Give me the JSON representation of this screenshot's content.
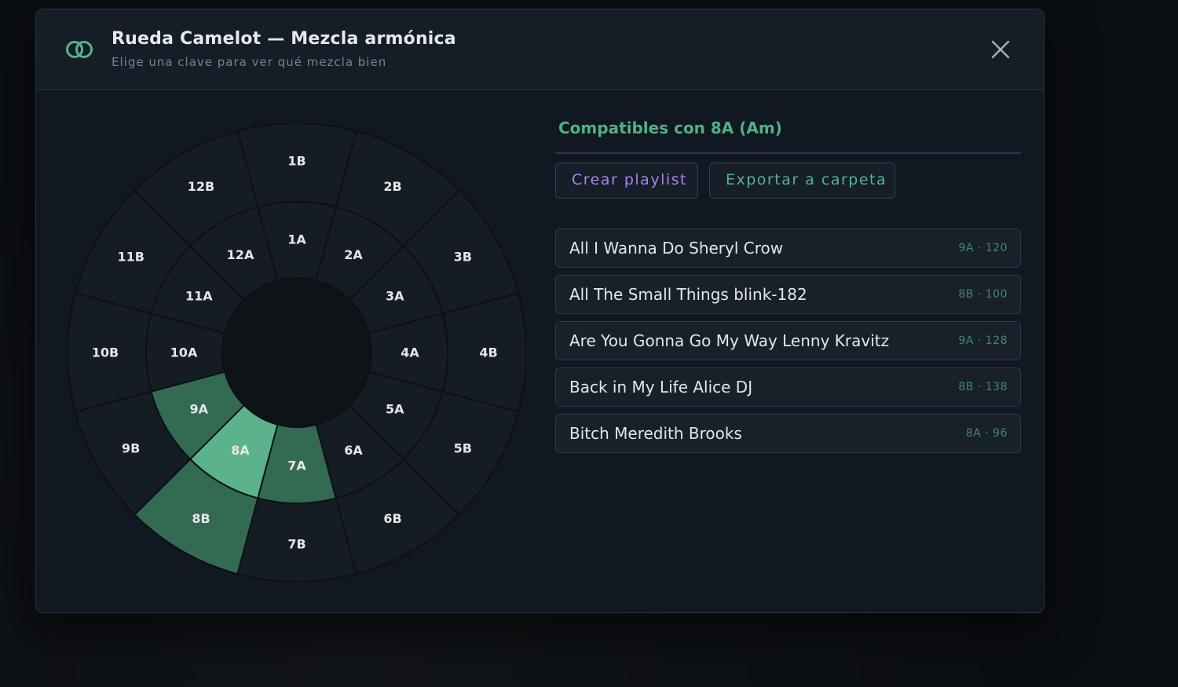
{
  "header": {
    "title": "Rueda Camelot — Mezcla armónica",
    "subtitle": "Elige una clave para ver qué mezcla bien"
  },
  "wheel": {
    "selected": "8A",
    "outer": [
      "1B",
      "2B",
      "3B",
      "4B",
      "5B",
      "6B",
      "7B",
      "8B",
      "9B",
      "10B",
      "11B",
      "12B"
    ],
    "inner": [
      "1A",
      "2A",
      "3A",
      "4A",
      "5A",
      "6A",
      "7A",
      "8A",
      "9A",
      "10A",
      "11A",
      "12A"
    ],
    "compatible": [
      "7A",
      "9A",
      "8B"
    ],
    "colors": {
      "base": "#161c24",
      "border": "#0c1016",
      "center": "#0e1318",
      "selected": "#5bb38c",
      "compatible": "#336a52"
    }
  },
  "panel": {
    "title": "Compatibles con 8A (Am)",
    "create_playlist": "Crear playlist",
    "export_folder": "Exportar a carpeta"
  },
  "tracks": [
    {
      "name": "All I Wanna Do Sheryl Crow",
      "meta": "9A · 120"
    },
    {
      "name": "All The Small Things blink-182",
      "meta": "8B · 100"
    },
    {
      "name": "Are You Gonna Go My Way Lenny Kravitz",
      "meta": "9A · 128"
    },
    {
      "name": "Back in My Life Alice DJ",
      "meta": "8B · 138"
    },
    {
      "name": "Bitch Meredith Brooks",
      "meta": "8A · 96"
    }
  ],
  "icons": {
    "logo": "linked-rings-icon",
    "close": "close-icon"
  },
  "accent": "#4fb184"
}
